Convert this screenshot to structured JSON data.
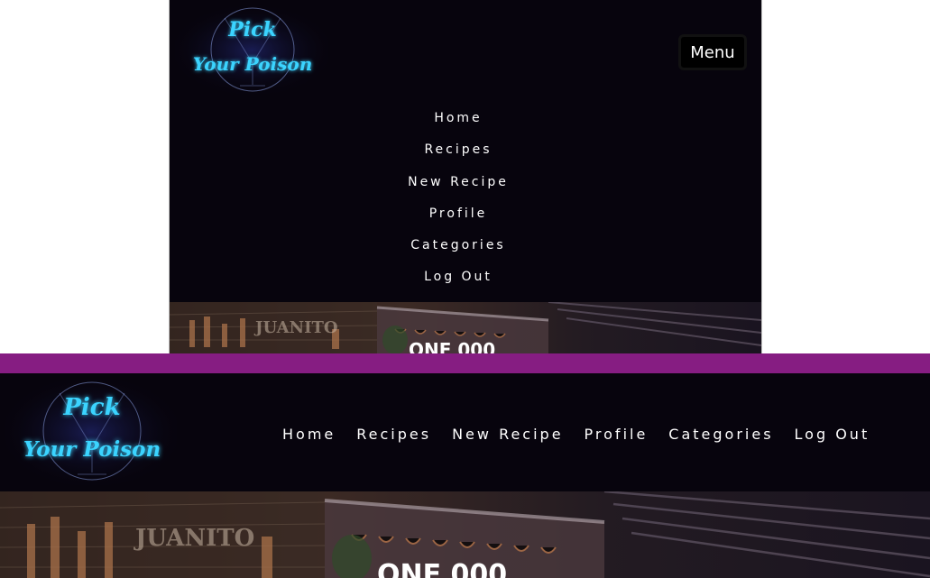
{
  "brand": {
    "logo_line1": "Pick",
    "logo_line2": "Your Poison",
    "neon_color": "#3ad4ff"
  },
  "mobile": {
    "menu_label": "Menu",
    "nav_items": [
      {
        "label": "Home"
      },
      {
        "label": "Recipes"
      },
      {
        "label": "New Recipe"
      },
      {
        "label": "Profile"
      },
      {
        "label": "Categories"
      },
      {
        "label": "Log Out"
      }
    ]
  },
  "desktop": {
    "nav_items": [
      {
        "label": "Home"
      },
      {
        "label": "Recipes"
      },
      {
        "label": "New Recipe"
      },
      {
        "label": "Profile"
      },
      {
        "label": "Categories"
      },
      {
        "label": "Log Out"
      }
    ]
  },
  "hero": {
    "sign_text": "ONE 000",
    "bar_sign_text": "JUANITO"
  },
  "colors": {
    "nav_background": "#07040d",
    "divider": "#861d82",
    "nav_text": "#ffffff"
  }
}
